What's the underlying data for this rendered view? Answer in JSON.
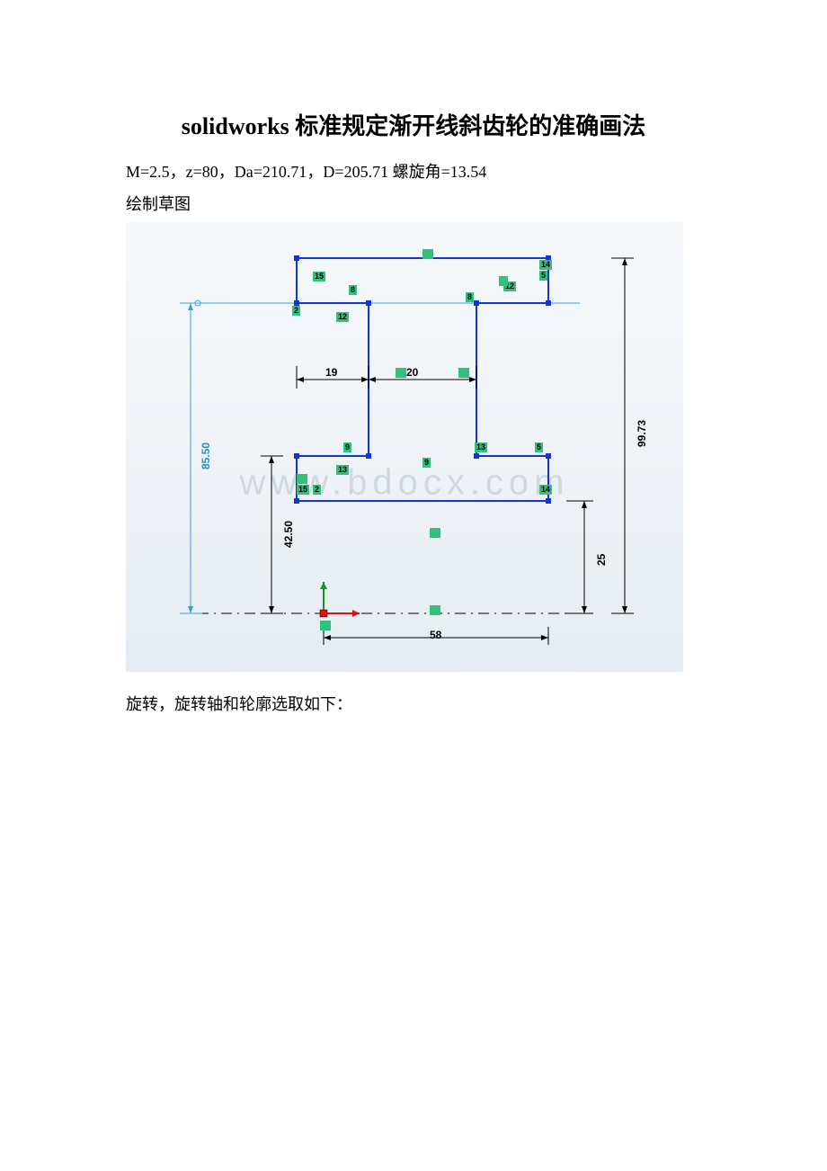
{
  "title": "solidworks 标准规定渐开线斜齿轮的准确画法",
  "params_line": "M=2.5，z=80，Da=210.71，D=205.71 螺旋角=13.54",
  "caption_sketch": "绘制草图",
  "caption_revolve": "旋转，旋转轴和轮廓选取如下：",
  "watermark": "www.bdocx.com",
  "dimensions": {
    "d19": "19",
    "d20": "20",
    "d58": "58",
    "d25": "25",
    "d42_50": "42.50",
    "d85_50": "85.50",
    "d99_73": "99.73"
  },
  "relations": {
    "r2a": "2",
    "r2b": "2",
    "r5a": "5",
    "r5b": "5",
    "r8a": "8",
    "r8b": "8",
    "r9a": "9",
    "r9b": "9",
    "r12a": "12",
    "r12b": "12",
    "r13a": "13",
    "r13b": "13",
    "r14a": "14",
    "r14b": "14",
    "r15a": "15",
    "r15b": "15"
  }
}
